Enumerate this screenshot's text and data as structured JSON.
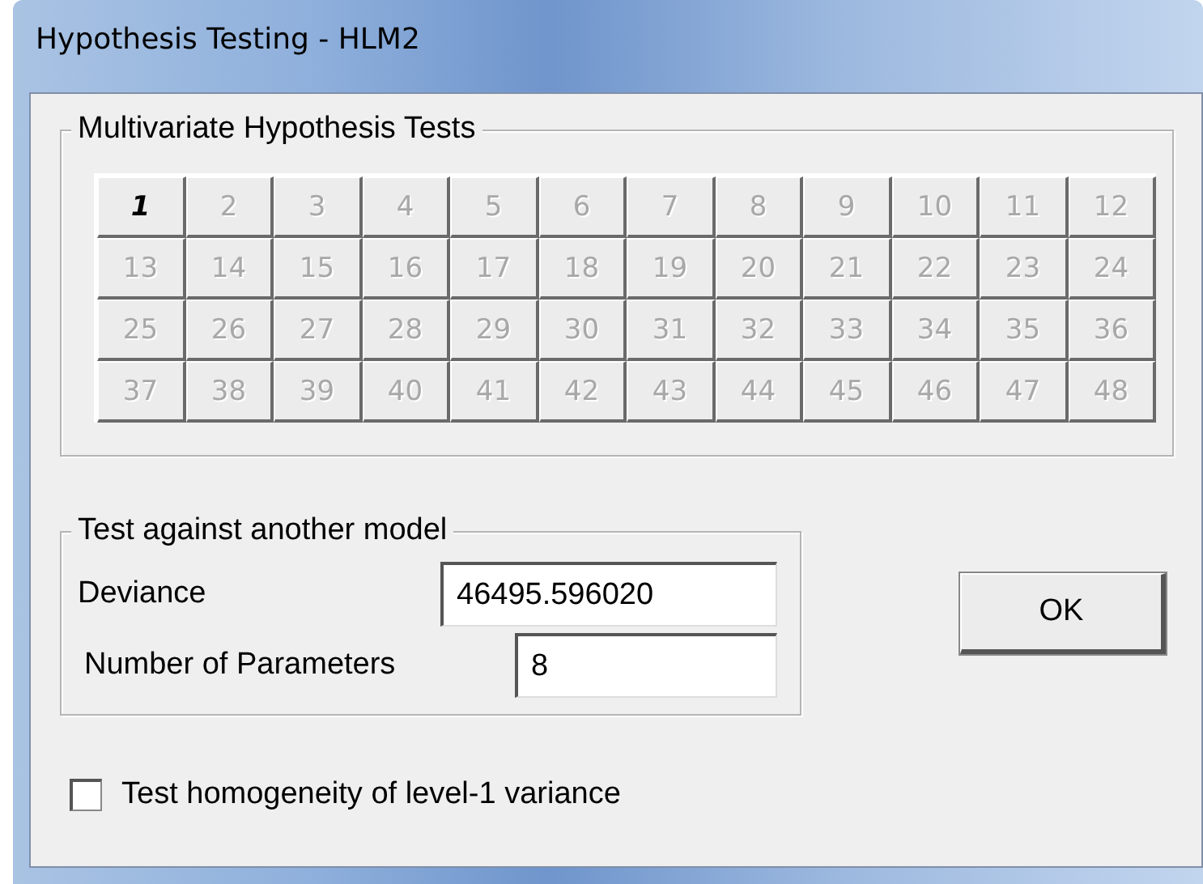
{
  "window": {
    "title": "Hypothesis Testing - HLM2"
  },
  "multivariate": {
    "title": "Multivariate Hypothesis Tests",
    "tests": [
      {
        "label": "1",
        "disabled": false
      },
      {
        "label": "2",
        "disabled": true
      },
      {
        "label": "3",
        "disabled": true
      },
      {
        "label": "4",
        "disabled": true
      },
      {
        "label": "5",
        "disabled": true
      },
      {
        "label": "6",
        "disabled": true
      },
      {
        "label": "7",
        "disabled": true
      },
      {
        "label": "8",
        "disabled": true
      },
      {
        "label": "9",
        "disabled": true
      },
      {
        "label": "10",
        "disabled": true
      },
      {
        "label": "11",
        "disabled": true
      },
      {
        "label": "12",
        "disabled": true
      },
      {
        "label": "13",
        "disabled": true
      },
      {
        "label": "14",
        "disabled": true
      },
      {
        "label": "15",
        "disabled": true
      },
      {
        "label": "16",
        "disabled": true
      },
      {
        "label": "17",
        "disabled": true
      },
      {
        "label": "18",
        "disabled": true
      },
      {
        "label": "19",
        "disabled": true
      },
      {
        "label": "20",
        "disabled": true
      },
      {
        "label": "21",
        "disabled": true
      },
      {
        "label": "22",
        "disabled": true
      },
      {
        "label": "23",
        "disabled": true
      },
      {
        "label": "24",
        "disabled": true
      },
      {
        "label": "25",
        "disabled": true
      },
      {
        "label": "26",
        "disabled": true
      },
      {
        "label": "27",
        "disabled": true
      },
      {
        "label": "28",
        "disabled": true
      },
      {
        "label": "29",
        "disabled": true
      },
      {
        "label": "30",
        "disabled": true
      },
      {
        "label": "31",
        "disabled": true
      },
      {
        "label": "32",
        "disabled": true
      },
      {
        "label": "33",
        "disabled": true
      },
      {
        "label": "34",
        "disabled": true
      },
      {
        "label": "35",
        "disabled": true
      },
      {
        "label": "36",
        "disabled": true
      },
      {
        "label": "37",
        "disabled": true
      },
      {
        "label": "38",
        "disabled": true
      },
      {
        "label": "39",
        "disabled": true
      },
      {
        "label": "40",
        "disabled": true
      },
      {
        "label": "41",
        "disabled": true
      },
      {
        "label": "42",
        "disabled": true
      },
      {
        "label": "43",
        "disabled": true
      },
      {
        "label": "44",
        "disabled": true
      },
      {
        "label": "45",
        "disabled": true
      },
      {
        "label": "46",
        "disabled": true
      },
      {
        "label": "47",
        "disabled": true
      },
      {
        "label": "48",
        "disabled": true
      }
    ]
  },
  "another_model": {
    "title": "Test against another model",
    "fields": [
      {
        "label": "Deviance",
        "value": "46495.596020"
      },
      {
        "label": "Number of Parameters",
        "value": "8"
      }
    ]
  },
  "ok_button": "OK",
  "homogeneity": {
    "label": "Test homogeneity of level-1 variance",
    "checked": false
  }
}
